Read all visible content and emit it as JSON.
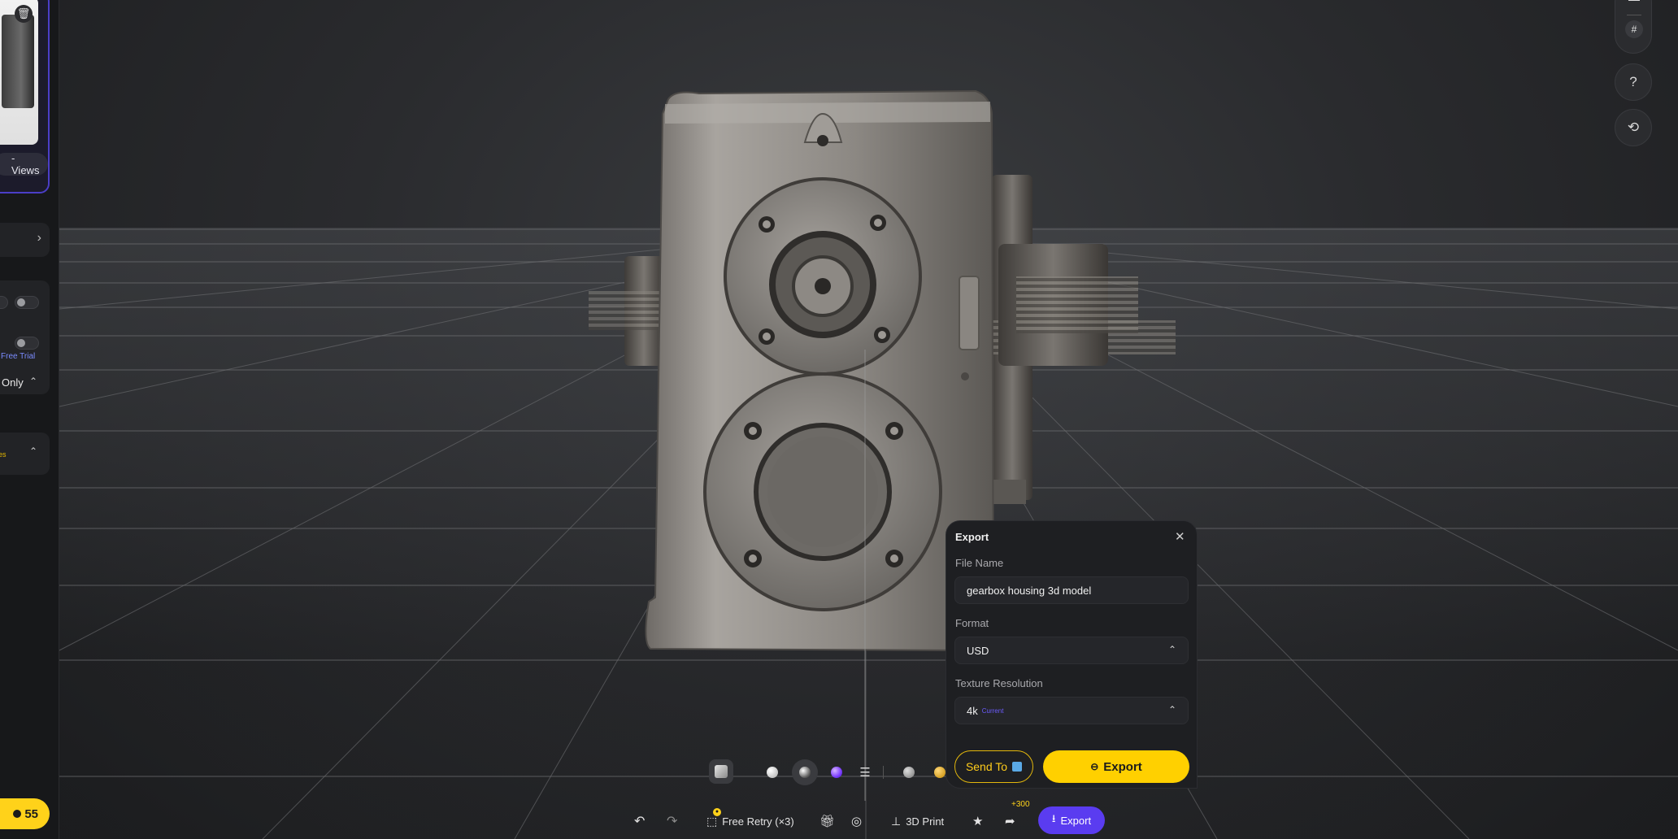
{
  "sidebar": {
    "views_chip": "-Views",
    "free_trial": "Free Trial",
    "only_label": "Only",
    "tag_text": "es",
    "credits": "55"
  },
  "rail": {
    "help_icon": "?",
    "history_icon": "history-icon"
  },
  "view_toolbar": {
    "icons": [
      "cube-icon",
      "white-material-icon",
      "clay-material-icon",
      "color-material-icon",
      "sliders-icon",
      "gray-material-icon",
      "gold-material-icon"
    ]
  },
  "action_bar": {
    "free_retry": "Free Retry (×3)",
    "print": "3D Print",
    "share_bonus": "+300",
    "export": "Export"
  },
  "export_panel": {
    "title": "Export",
    "file_name_label": "File Name",
    "file_name_value": "gearbox housing 3d model",
    "format_label": "Format",
    "format_value": "USD",
    "texture_label": "Texture Resolution",
    "texture_value": "4k",
    "texture_sub": "Current",
    "send_to": "Send To",
    "export_button": "Export"
  },
  "colors": {
    "accent_purple": "#5a3cf0",
    "accent_yellow": "#ffd000"
  }
}
